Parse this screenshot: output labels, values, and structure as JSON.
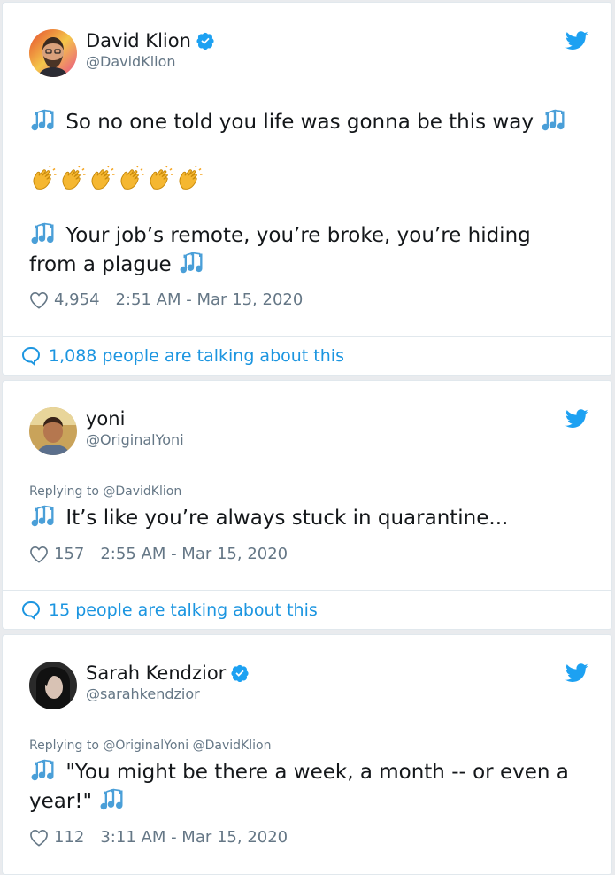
{
  "tweets": [
    {
      "name": "David Klion",
      "handle": "@DavidKlion",
      "verified": true,
      "line1": "So no one told you life was gonna be this way",
      "line2": "Your job’s remote, you’re broke, you’re hiding",
      "line3": "from a plague",
      "likes": "4,954",
      "timestamp": "2:51 AM - Mar 15, 2020",
      "talking": "1,088 people are talking about this"
    },
    {
      "name": "yoni",
      "handle": "@OriginalYoni",
      "verified": false,
      "replying": "Replying to @DavidKlion",
      "line1": "It’s like you’re always stuck in quarantine...",
      "likes": "157",
      "timestamp": "2:55 AM - Mar 15, 2020",
      "talking": "15 people are talking about this"
    },
    {
      "name": "Sarah Kendzior",
      "handle": "@sarahkendzior",
      "verified": true,
      "replying": "Replying to @OriginalYoni @DavidKlion",
      "line1": "\"You might be there a week, a month -- or even a",
      "line2": "year!\"",
      "likes": "112",
      "timestamp": "3:11 AM - Mar 15, 2020"
    }
  ],
  "icons": {
    "music": "music-notes-icon",
    "clap": "clapping-hands-icon",
    "bird": "twitter-bird-icon",
    "verified": "verified-badge-icon",
    "heart": "heart-icon",
    "bubble": "comment-bubble-icon"
  },
  "colors": {
    "accent": "#1da1f2",
    "link": "#1b95e0",
    "muted": "#657786",
    "note": "#4a9fd8"
  }
}
